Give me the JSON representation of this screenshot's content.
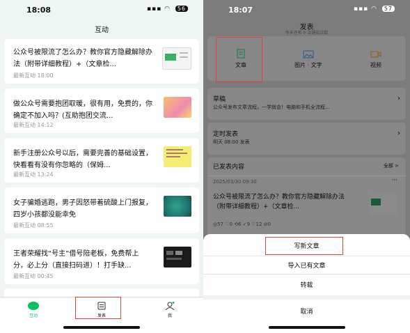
{
  "left": {
    "status_time": "18:08",
    "battery": "56",
    "header_title": "互动",
    "cards": [
      {
        "title": "公众号被限流了怎么办？教你官方隐藏解除办法（附带详细教程）+（文章检...",
        "meta": "最新互动 18:00"
      },
      {
        "title": "做公众号需要抱团取暖，很有用，免费的，你确定不加入吗？(互助抱团交流...",
        "meta": "最新互动 14:12"
      },
      {
        "title": "新手注册公众号以后，需要完善的基础设置，快看看有没有你忽略的（保姆...",
        "meta": "最新互动 13:24"
      },
      {
        "title": "女子骗婚逃跑，男子因怒带着硫酸上门报复，四岁小孩都没能幸免",
        "meta": "最新互动 08:55"
      },
      {
        "title": "王者荣耀找“号主”借号陪老板，免费帮上分，必上分（直接扫码进）！打手缺...",
        "meta": "最新互动 00:45"
      }
    ],
    "tabs": {
      "interact": "互动",
      "publish": "发表",
      "me": "我"
    }
  },
  "right": {
    "status_time": "18:07",
    "battery": "57",
    "header_title": "发表",
    "header_sub": "今天还有 0 次通知次数",
    "types": {
      "article": "文章",
      "image_text": "图片 · 文字",
      "video": "视频"
    },
    "drafts_title": "草稿",
    "drafts_sub": "公众号发布文章流程，一学就会！电脑和手机全流程...",
    "scheduled_title": "定时发表",
    "scheduled_sub": "明天 08:00 发表",
    "published_title": "已发表内容",
    "published_all": "全部 >",
    "pub_date": "2025/03/30 09:30",
    "pub_title": "公众号被限流了怎么办？教你官方隐藏解除办法（附带详细教程）+（文章检...",
    "pub_stats": "◎57  ♡0  ⟲6  ✓9  ♡12  ⊘0",
    "sheet": {
      "write_new": "写新文章",
      "import_existing": "导入已有文章",
      "repost": "转载",
      "cancel": "取消"
    }
  }
}
